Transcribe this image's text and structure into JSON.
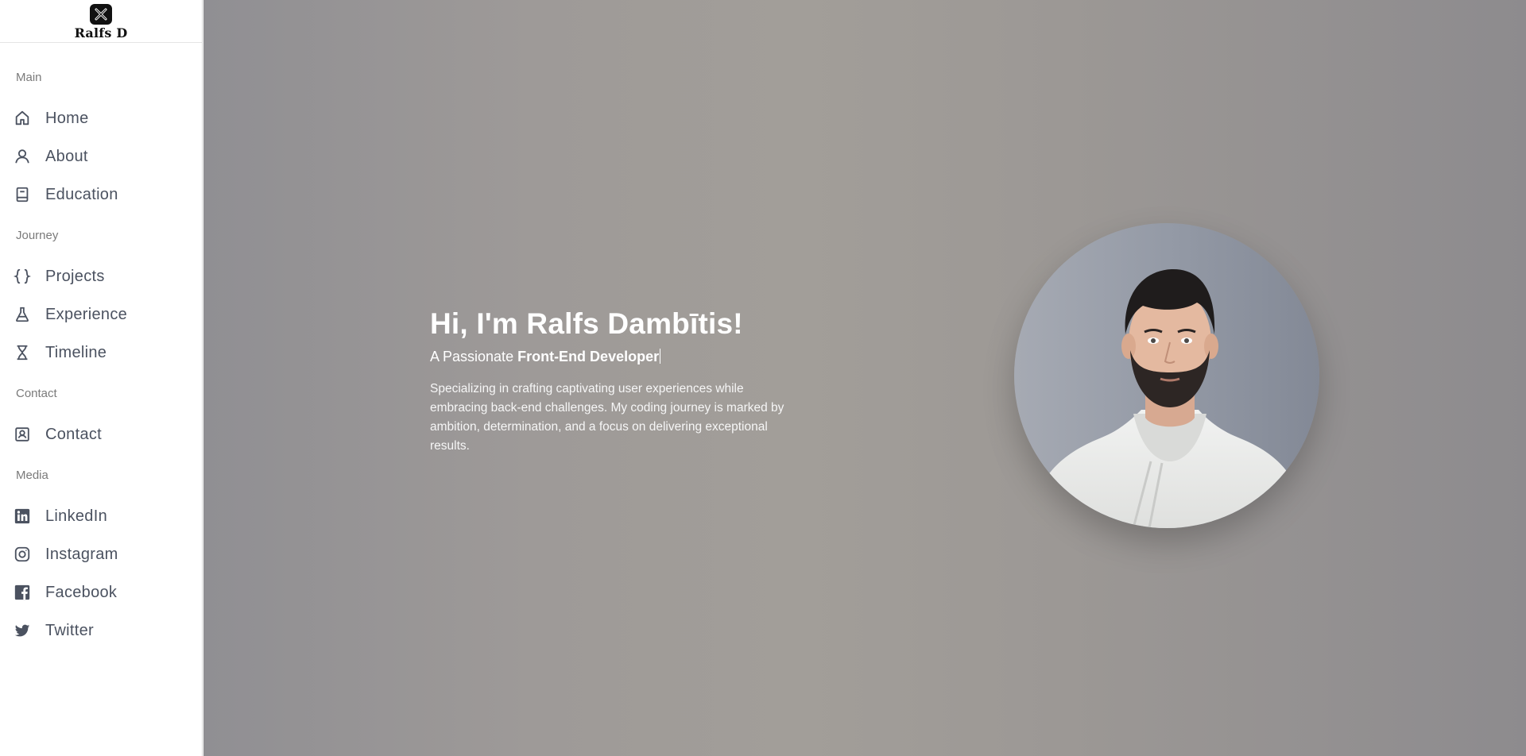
{
  "brand": {
    "name": "Ralfs D",
    "logo_icon": "x-logo-icon"
  },
  "sidebar": {
    "sections": [
      {
        "label": "Main",
        "items": [
          {
            "label": "Home",
            "icon": "home-icon"
          },
          {
            "label": "About",
            "icon": "user-icon"
          },
          {
            "label": "Education",
            "icon": "book-icon"
          }
        ]
      },
      {
        "label": "Journey",
        "items": [
          {
            "label": "Projects",
            "icon": "braces-icon"
          },
          {
            "label": "Experience",
            "icon": "flask-icon"
          },
          {
            "label": "Timeline",
            "icon": "hourglass-icon"
          }
        ]
      },
      {
        "label": "Contact",
        "items": [
          {
            "label": "Contact",
            "icon": "contact-card-icon"
          }
        ]
      },
      {
        "label": "Media",
        "items": [
          {
            "label": "LinkedIn",
            "icon": "linkedin-icon"
          },
          {
            "label": "Instagram",
            "icon": "instagram-icon"
          },
          {
            "label": "Facebook",
            "icon": "facebook-icon"
          },
          {
            "label": "Twitter",
            "icon": "twitter-icon"
          }
        ]
      }
    ]
  },
  "hero": {
    "title": "Hi, I'm Ralfs Dambītis!",
    "subtitle_prefix": "A Passionate ",
    "subtitle_role": "Front-End Developer",
    "description": "Specializing in crafting captivating user experiences while embracing back-end challenges. My coding journey is marked by ambition, determination, and a focus on delivering exceptional results."
  },
  "colors": {
    "sidebar_text": "#4b5260",
    "section_label": "#7a7a7a",
    "hero_text": "#ffffff"
  }
}
